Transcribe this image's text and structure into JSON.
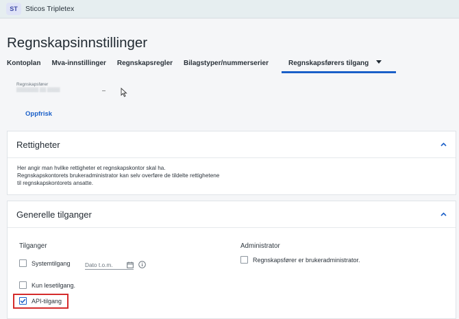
{
  "topbar": {
    "avatar": "ST",
    "company": "Sticos Tripletex"
  },
  "page": {
    "title": "Regnskapsinnstillinger"
  },
  "tabs": [
    {
      "label": "Kontoplan"
    },
    {
      "label": "Mva-innstillinger"
    },
    {
      "label": "Regnskapsregler"
    },
    {
      "label": "Bilagstyper/nummerserier"
    },
    {
      "label": "Regnskapsførers tilgang"
    }
  ],
  "accountant": {
    "label": "Regnskapsfører",
    "value": "▒▒▒▒▒▒▒ ▒▒ ▒▒▒▒",
    "dash": "–"
  },
  "refresh_label": "Oppfrisk",
  "rights": {
    "title": "Rettigheter",
    "lines": [
      "Her angir man hvilke rettigheter et regnskapskontor skal ha.",
      "Regnskapskontorets brukeradministrator kan selv overføre de tildelte rettighetene",
      "til regnskapskontorets ansatte."
    ]
  },
  "general": {
    "title": "Generelle tilganger",
    "access_label": "Tilganger",
    "admin_label": "Administrator",
    "system_access": {
      "label": "Systemtilgang",
      "checked": false
    },
    "date_placeholder": "Dato t.o.m.",
    "readonly_access": {
      "label": "Kun lesetilgang.",
      "checked": false
    },
    "api_access": {
      "label": "API-tilgang",
      "checked": true
    },
    "admin_option": {
      "label": "Regnskapsfører er brukeradministrator.",
      "checked": false
    }
  },
  "colors": {
    "accent": "#1a5fc8",
    "highlight": "#d42a2a",
    "topbar": "#e6eef0"
  }
}
